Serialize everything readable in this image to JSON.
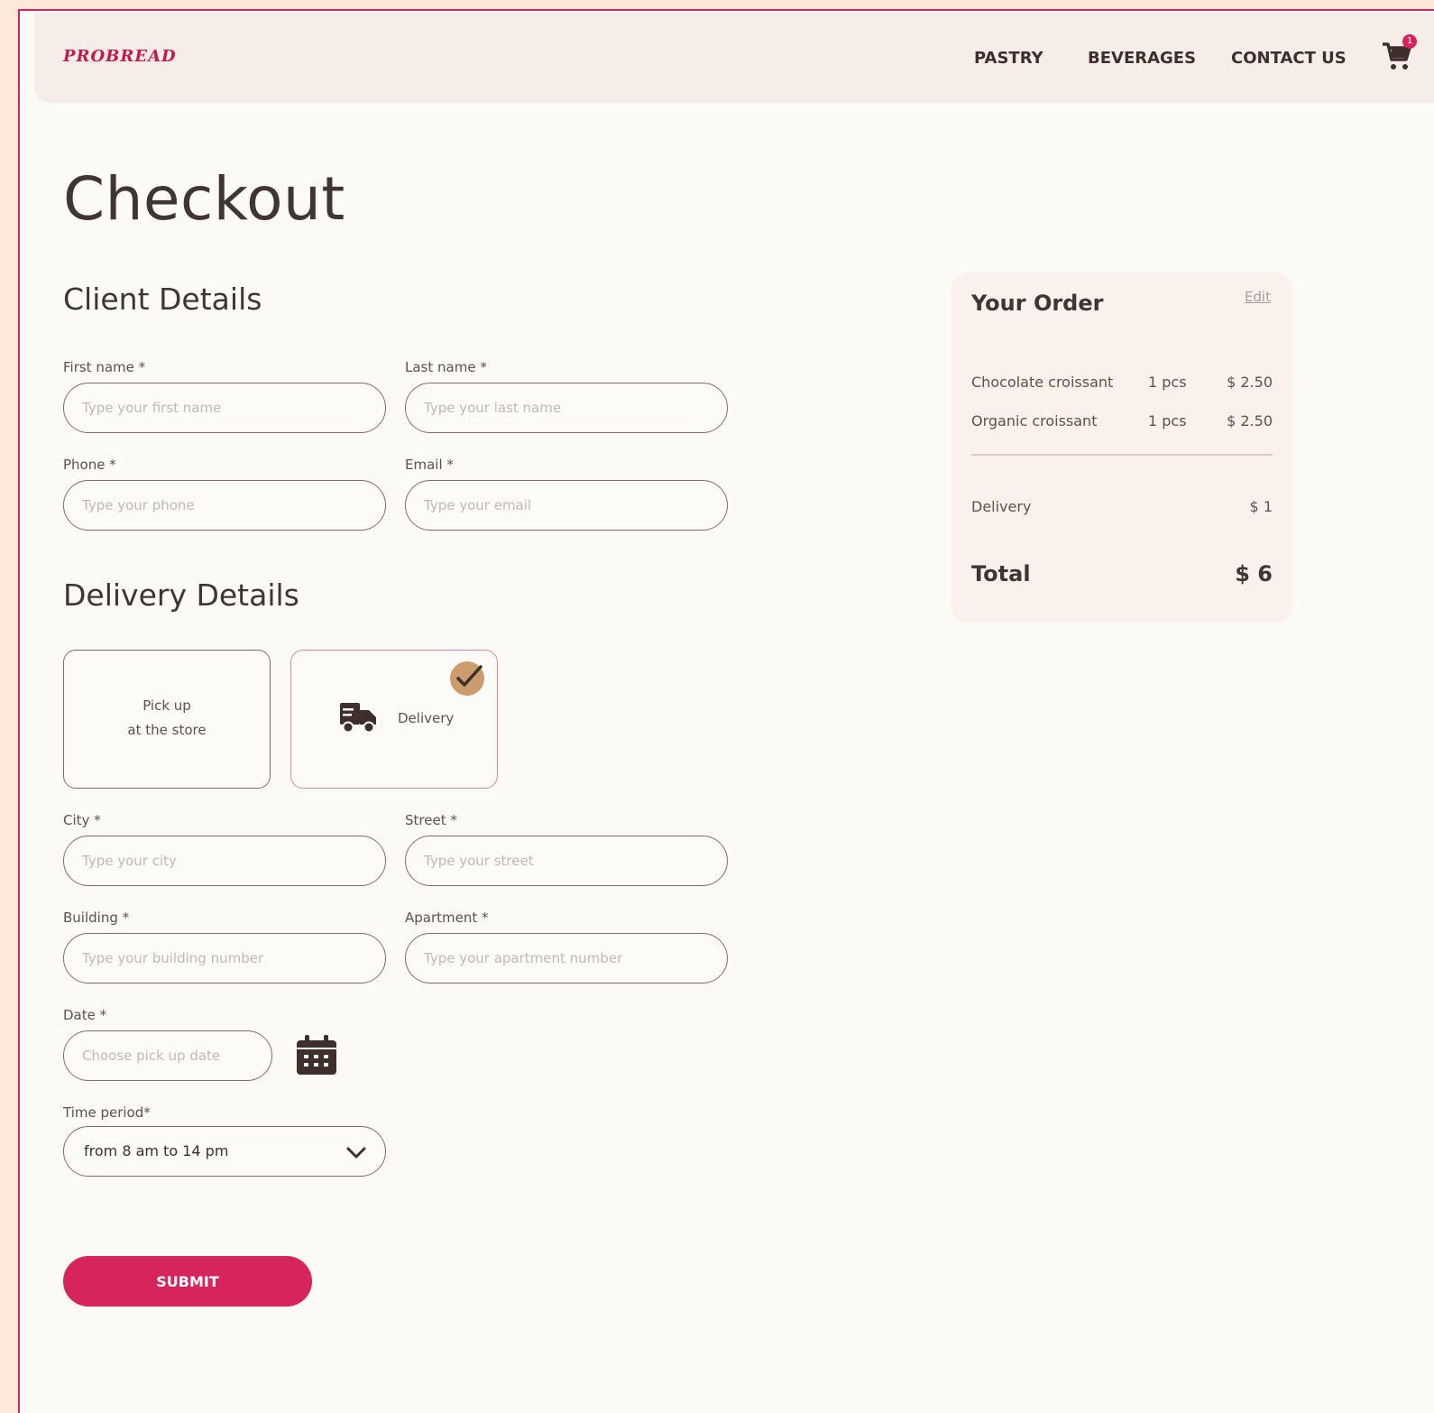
{
  "brand": {
    "logo": "PROBREAD",
    "accent": "#d6245c"
  },
  "nav": {
    "links": [
      "PASTRY",
      "BEVERAGES",
      "CONTACT US"
    ],
    "cart_count": "1"
  },
  "page_title": "Checkout",
  "client_details": {
    "heading": "Client Details",
    "first_name": {
      "label": "First name *",
      "placeholder": "Type your first name"
    },
    "last_name": {
      "label": "Last name *",
      "placeholder": "Type your last name"
    },
    "phone": {
      "label": "Phone *",
      "placeholder": "Type your phone"
    },
    "email": {
      "label": "Email *",
      "placeholder": "Type your email"
    }
  },
  "delivery_details": {
    "heading": "Delivery Details",
    "options": {
      "pickup_line1": "Pick up",
      "pickup_line2": "at the store",
      "delivery": "Delivery",
      "selected": "delivery"
    },
    "city": {
      "label": "City *",
      "placeholder": "Type your city"
    },
    "street": {
      "label": "Street *",
      "placeholder": "Type your street"
    },
    "building": {
      "label": "Building *",
      "placeholder": "Type your building number"
    },
    "apartment": {
      "label": "Apartment *",
      "placeholder": "Type your apartment number"
    },
    "date": {
      "label": "Date *",
      "placeholder": "Choose pick up date"
    },
    "time_period": {
      "label": "Time period*",
      "value": "from 8 am to 14 pm"
    }
  },
  "submit_label": "SUBMIT",
  "order": {
    "title": "Your Order",
    "edit_label": "Edit",
    "items": [
      {
        "name": "Chocolate croissant",
        "qty": "1 pcs",
        "price": "$ 2.50"
      },
      {
        "name": "Organic croissant",
        "qty": "1 pcs",
        "price": "$ 2.50"
      }
    ],
    "delivery_label": "Delivery",
    "delivery_price": "$ 1",
    "total_label": "Total",
    "total_price": "$ 6"
  }
}
